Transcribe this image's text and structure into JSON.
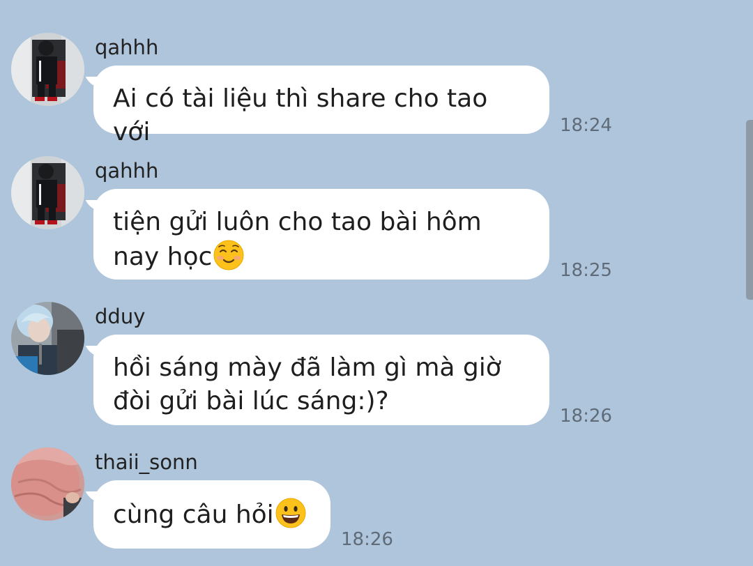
{
  "messages": [
    {
      "sender": "qahhh",
      "text": "Ai có tài liệu thì share cho tao với",
      "emoji": null,
      "time": "18:24",
      "avatar": "avatar-person-car-icon"
    },
    {
      "sender": "qahhh",
      "text": "tiện gửi luôn cho tao bài hôm\nnay học",
      "emoji": "smiling-face-icon",
      "time": "18:25",
      "avatar": "avatar-person-car-icon"
    },
    {
      "sender": "dduy",
      "text": "hồi sáng mày đã làm gì mà giờ\nđòi gửi bài lúc sáng:)?",
      "emoji": null,
      "time": "18:26",
      "avatar": "avatar-blue-hair-icon"
    },
    {
      "sender": "thaii_sonn",
      "text": "cùng câu hỏi",
      "emoji": "grinning-face-icon",
      "time": "18:26",
      "avatar": "avatar-pink-hair-icon"
    }
  ],
  "colors": {
    "background": "#afc5db",
    "bubble": "#ffffff",
    "timestamp": "#5f6b78",
    "text": "#1e1e1e"
  }
}
